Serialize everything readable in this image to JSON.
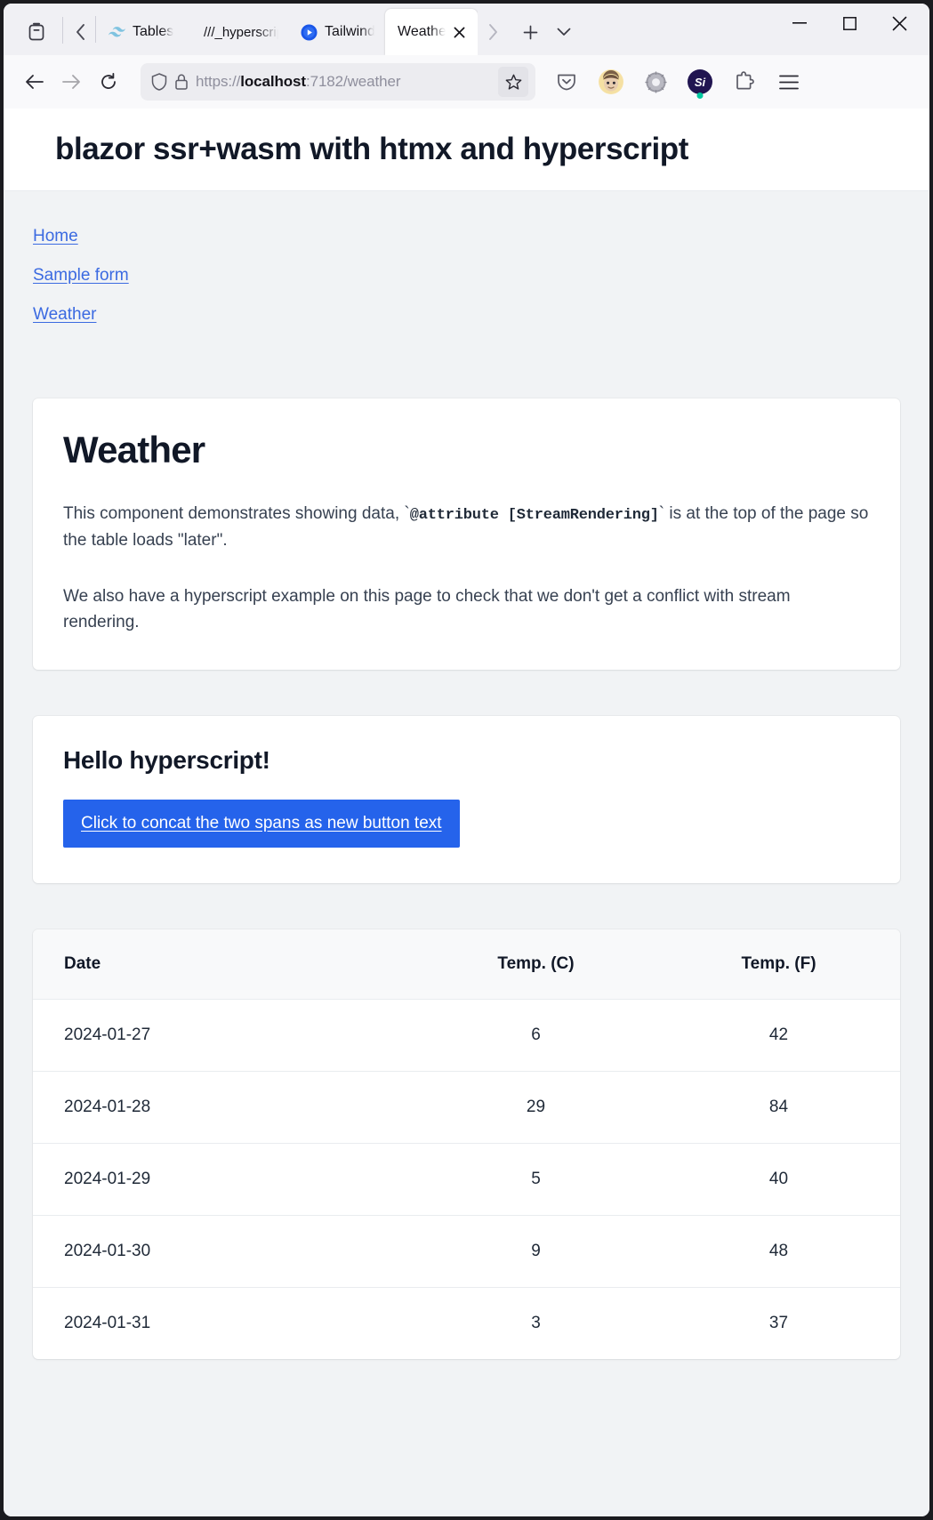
{
  "browser": {
    "firefox_view_label": "Firefox View",
    "tab_scroll_left": "Scroll tabs left",
    "tab_scroll_right": "Scroll tabs right",
    "new_tab_label": "+",
    "tab_list_label": "List all tabs",
    "minimize_label": "Minimize",
    "maximize_label": "Maximize",
    "close_label": "Close",
    "tabs": [
      {
        "title": "Tables",
        "favicon": "tailwind-wave-icon",
        "active": false
      },
      {
        "title": "///_hyperscript",
        "favicon": "hyperscript-icon",
        "active": false
      },
      {
        "title": "Tailwind CSS",
        "favicon": "play-circle-icon",
        "active": false
      },
      {
        "title": "Weather",
        "favicon": "none",
        "active": true,
        "close_label": "✕"
      }
    ],
    "toolbar": {
      "back_label": "Back",
      "forward_label": "Forward",
      "reload_label": "Reload",
      "url_prefix": "https://",
      "url_host": "localhost",
      "url_rest": ":7182/weather",
      "url_full": "https://localhost:7182/weather",
      "bookmark_label": "Bookmark this page",
      "shield_label": "Tracking protection",
      "lock_label": "Connection secure",
      "extensions": [
        {
          "name": "pocket-icon",
          "label": "Save to Pocket"
        },
        {
          "name": "avatar-extension-icon",
          "label": "Account extension"
        },
        {
          "name": "gear-extension-icon",
          "label": "Settings extension"
        },
        {
          "name": "si-extension-icon",
          "label": "Si",
          "badge": true
        },
        {
          "name": "puzzle-icon",
          "label": "Extensions"
        },
        {
          "name": "hamburger-menu-icon",
          "label": "Open application menu"
        }
      ]
    }
  },
  "page": {
    "header_title": "blazor ssr+wasm with htmx and hyperscript",
    "nav": [
      {
        "label": "Home"
      },
      {
        "label": "Sample form"
      },
      {
        "label": "Weather"
      }
    ],
    "weather_card": {
      "heading": "Weather",
      "paragraph1_before": "This component demonstrates showing data, `",
      "paragraph1_code": "@attribute [StreamRendering]",
      "paragraph1_after": "` is at the top of the page so the table loads \"later\".",
      "paragraph2": "We also have a hyperscript example on this page to check that we don't get a conflict with stream rendering."
    },
    "hyperscript_card": {
      "heading": "Hello hyperscript!",
      "button_label": "Click to concat the two spans as new button text",
      "button_color": "#2563eb"
    },
    "table": {
      "columns": [
        "Date",
        "Temp. (C)",
        "Temp. (F)"
      ],
      "rows": [
        {
          "date": "2024-01-27",
          "c": "6",
          "f": "42"
        },
        {
          "date": "2024-01-28",
          "c": "29",
          "f": "84"
        },
        {
          "date": "2024-01-29",
          "c": "5",
          "f": "40"
        },
        {
          "date": "2024-01-30",
          "c": "9",
          "f": "48"
        },
        {
          "date": "2024-01-31",
          "c": "3",
          "f": "37"
        }
      ]
    }
  }
}
